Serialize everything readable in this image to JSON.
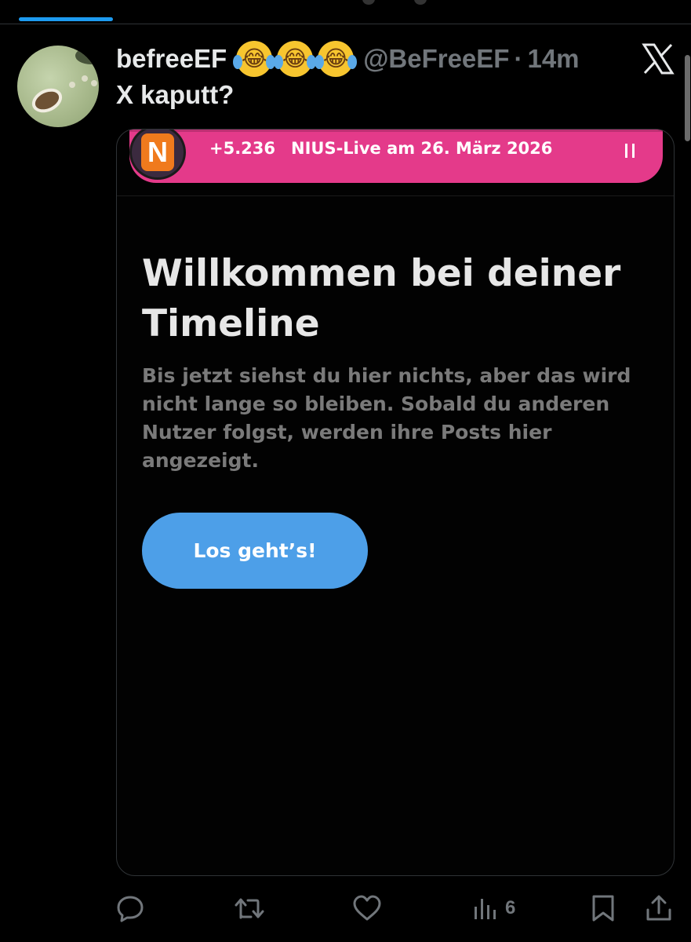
{
  "post": {
    "display_name": "befreeEF",
    "name_emojis": [
      "😂",
      "😂",
      "😂"
    ],
    "handle": "@BeFreeEF",
    "separator": "·",
    "time": "14m",
    "text": "X kaputt?"
  },
  "media": {
    "live_banner": {
      "logo_letter": "N",
      "viewer_count": "+5.236",
      "title": "NIUS-Live am 26. März 2026"
    },
    "heading": "Willkommen bei deiner Timeline",
    "body": "Bis jetzt siehst du hier nichts, aber das wird nicht lange so bleiben. Sobald du anderen Nutzer folgst, werden ihre Posts hier angezeigt.",
    "cta_label": "Los geht’s!"
  },
  "actions": {
    "views_count": "6",
    "icons": [
      "reply-icon",
      "repost-icon",
      "like-icon",
      "views-icon",
      "bookmark-icon",
      "share-icon"
    ]
  },
  "colors": {
    "background": "#000000",
    "accent": "#1d9bf0",
    "banner_pink": "#e43a8a",
    "cta_blue": "#4d9fe8",
    "muted": "#71767b"
  }
}
